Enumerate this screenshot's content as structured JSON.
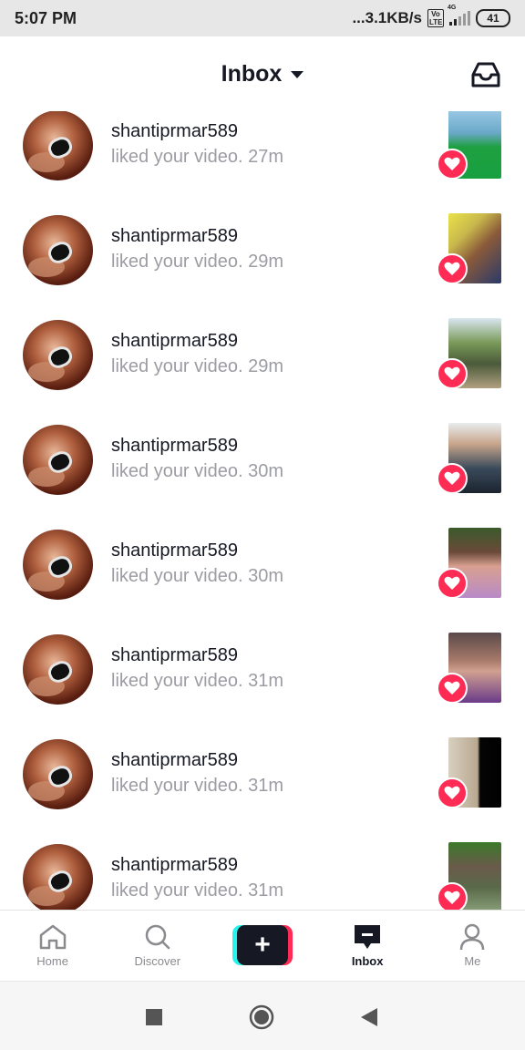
{
  "status_bar": {
    "time": "5:07 PM",
    "network_speed": "...3.1KB/s",
    "volte_badge": "Vo LTE",
    "signal_label": "4G",
    "battery": "41"
  },
  "header": {
    "title": "Inbox"
  },
  "notifications": [
    {
      "username": "shantiprmar589",
      "action": "liked your video.",
      "time": "27m"
    },
    {
      "username": "shantiprmar589",
      "action": "liked your video.",
      "time": "29m"
    },
    {
      "username": "shantiprmar589",
      "action": "liked your video.",
      "time": "29m"
    },
    {
      "username": "shantiprmar589",
      "action": "liked your video.",
      "time": "30m"
    },
    {
      "username": "shantiprmar589",
      "action": "liked your video.",
      "time": "30m"
    },
    {
      "username": "shantiprmar589",
      "action": "liked your video.",
      "time": "31m"
    },
    {
      "username": "shantiprmar589",
      "action": "liked your video.",
      "time": "31m"
    },
    {
      "username": "shantiprmar589",
      "action": "liked your video.",
      "time": "31m"
    }
  ],
  "bottom_nav": [
    {
      "label": "Home",
      "icon": "home-icon"
    },
    {
      "label": "Discover",
      "icon": "search-icon"
    },
    {
      "label": "",
      "icon": "plus-icon"
    },
    {
      "label": "Inbox",
      "icon": "inbox-message-icon",
      "active": true
    },
    {
      "label": "Me",
      "icon": "person-icon"
    }
  ],
  "colors": {
    "heart": "#fe2c55",
    "cyan": "#25f4ee",
    "text_primary": "#161823",
    "text_secondary": "#9c9ca3"
  }
}
